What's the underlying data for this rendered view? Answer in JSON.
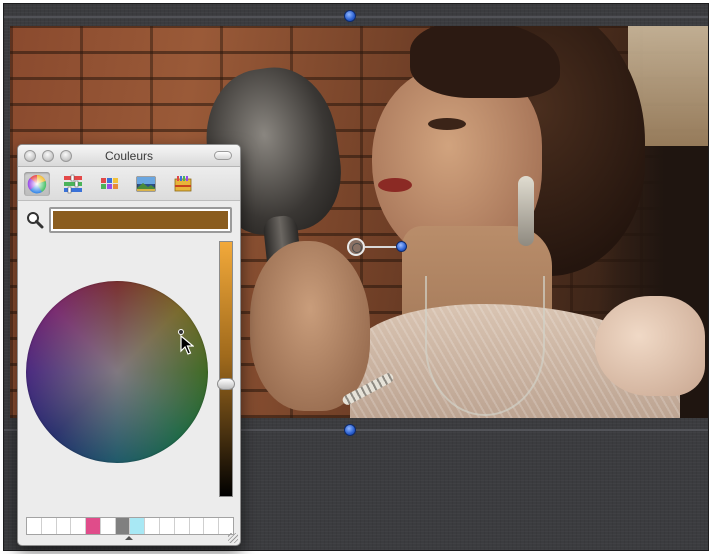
{
  "panel": {
    "title": "Couleurs",
    "modes": [
      {
        "name": "color-wheel-mode",
        "icon": "color-wheel-icon",
        "active": true
      },
      {
        "name": "color-sliders-mode",
        "icon": "sliders-icon",
        "active": false
      },
      {
        "name": "color-palettes-mode",
        "icon": "palette-grid-icon",
        "active": false
      },
      {
        "name": "image-palettes-mode",
        "icon": "image-palette-icon",
        "active": false
      },
      {
        "name": "crayons-mode",
        "icon": "crayon-box-icon",
        "active": false
      }
    ],
    "current_color": "#8a5c1e",
    "swatches": [
      "#ffffff",
      "#ffffff",
      "#ffffff",
      "#ffffff",
      "#e04c8a",
      "#ffffff",
      "#808080",
      "#a8e8f4",
      "#ffffff",
      "#ffffff",
      "#ffffff",
      "#ffffff",
      "#ffffff",
      "#ffffff"
    ]
  },
  "colors": {
    "canvas_background": "#3b3c3f",
    "guide_knob": "#2a5fd0",
    "brightness_top": "#f2a93a",
    "brightness_bottom": "#000000"
  }
}
